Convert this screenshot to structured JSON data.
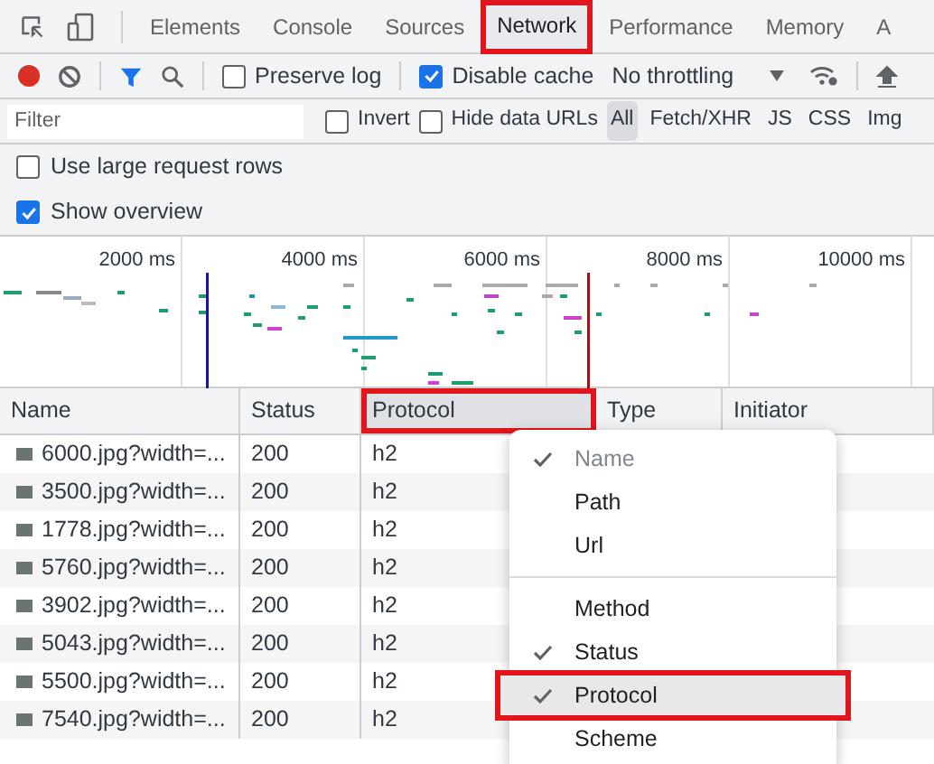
{
  "tabs": [
    {
      "label": "Elements",
      "selected": false,
      "annotated": false
    },
    {
      "label": "Console",
      "selected": false,
      "annotated": false
    },
    {
      "label": "Sources",
      "selected": false,
      "annotated": false
    },
    {
      "label": "Network",
      "selected": true,
      "annotated": true
    },
    {
      "label": "Performance",
      "selected": false,
      "annotated": false
    },
    {
      "label": "Memory",
      "selected": false,
      "annotated": false
    },
    {
      "label": "A",
      "selected": false,
      "annotated": false
    }
  ],
  "toolbar": {
    "recording": true,
    "preserve_log": {
      "label": "Preserve log",
      "checked": false
    },
    "disable_cache": {
      "label": "Disable cache",
      "checked": true
    },
    "throttling": "No throttling"
  },
  "filter_bar": {
    "placeholder": "Filter",
    "invert": {
      "label": "Invert",
      "checked": false
    },
    "hide_data_urls": {
      "label": "Hide data URLs",
      "checked": false
    },
    "types": [
      {
        "label": "All",
        "selected": true
      },
      {
        "label": "Fetch/XHR",
        "selected": false
      },
      {
        "label": "JS",
        "selected": false
      },
      {
        "label": "CSS",
        "selected": false
      },
      {
        "label": "Img",
        "selected": false
      }
    ]
  },
  "options": [
    {
      "label": "Use large request rows",
      "checked": false
    },
    {
      "label": "Show overview",
      "checked": true
    }
  ],
  "overview": {
    "time_labels": [
      "2000 ms",
      "4000 ms",
      "6000 ms",
      "8000 ms",
      "10000 ms"
    ]
  },
  "table": {
    "columns": [
      {
        "label": "Name",
        "annotated": false
      },
      {
        "label": "Status",
        "annotated": false
      },
      {
        "label": "Protocol",
        "annotated": true
      },
      {
        "label": "Type",
        "annotated": false
      },
      {
        "label": "Initiator",
        "annotated": false
      }
    ],
    "rows": [
      {
        "name": "6000.jpg?width=...",
        "status": "200",
        "protocol": "h2"
      },
      {
        "name": "3500.jpg?width=...",
        "status": "200",
        "protocol": "h2"
      },
      {
        "name": "1778.jpg?width=...",
        "status": "200",
        "protocol": "h2"
      },
      {
        "name": "5760.jpg?width=...",
        "status": "200",
        "protocol": "h2"
      },
      {
        "name": "3902.jpg?width=...",
        "status": "200",
        "protocol": "h2"
      },
      {
        "name": "5043.jpg?width=...",
        "status": "200",
        "protocol": "h2"
      },
      {
        "name": "5500.jpg?width=...",
        "status": "200",
        "protocol": "h2"
      },
      {
        "name": "7540.jpg?width=...",
        "status": "200",
        "protocol": "h2"
      }
    ]
  },
  "context_menu": {
    "items": [
      {
        "kind": "item",
        "label": "Name",
        "checked": true,
        "disabled": true,
        "annotated": false
      },
      {
        "kind": "item",
        "label": "Path",
        "checked": false,
        "disabled": false,
        "annotated": false
      },
      {
        "kind": "item",
        "label": "Url",
        "checked": false,
        "disabled": false,
        "annotated": false
      },
      {
        "kind": "separator"
      },
      {
        "kind": "item",
        "label": "Method",
        "checked": false,
        "disabled": false,
        "annotated": false
      },
      {
        "kind": "item",
        "label": "Status",
        "checked": true,
        "disabled": false,
        "annotated": false
      },
      {
        "kind": "item",
        "label": "Protocol",
        "checked": true,
        "disabled": false,
        "annotated": true
      },
      {
        "kind": "item",
        "label": "Scheme",
        "checked": false,
        "disabled": false,
        "annotated": false
      }
    ]
  }
}
